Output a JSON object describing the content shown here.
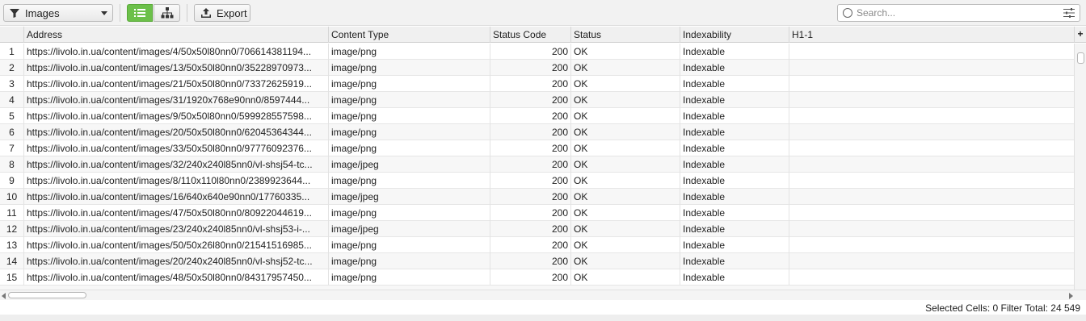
{
  "toolbar": {
    "filter_value": "Images",
    "export_label": "Export",
    "search_placeholder": "Search...",
    "accent_color": "#6cc04a"
  },
  "table": {
    "columns": [
      "",
      "Address",
      "Content Type",
      "Status Code",
      "Status",
      "Indexability",
      "H1-1"
    ],
    "rows": [
      {
        "idx": "1",
        "address": "https://livolo.in.ua/content/images/4/50x50l80nn0/706614381194...",
        "content_type": "image/png",
        "status_code": "200",
        "status": "OK",
        "indexability": "Indexable",
        "h1": ""
      },
      {
        "idx": "2",
        "address": "https://livolo.in.ua/content/images/13/50x50l80nn0/35228970973...",
        "content_type": "image/png",
        "status_code": "200",
        "status": "OK",
        "indexability": "Indexable",
        "h1": ""
      },
      {
        "idx": "3",
        "address": "https://livolo.in.ua/content/images/21/50x50l80nn0/73372625919...",
        "content_type": "image/png",
        "status_code": "200",
        "status": "OK",
        "indexability": "Indexable",
        "h1": ""
      },
      {
        "idx": "4",
        "address": "https://livolo.in.ua/content/images/31/1920x768e90nn0/8597444...",
        "content_type": "image/png",
        "status_code": "200",
        "status": "OK",
        "indexability": "Indexable",
        "h1": ""
      },
      {
        "idx": "5",
        "address": "https://livolo.in.ua/content/images/9/50x50l80nn0/599928557598...",
        "content_type": "image/png",
        "status_code": "200",
        "status": "OK",
        "indexability": "Indexable",
        "h1": ""
      },
      {
        "idx": "6",
        "address": "https://livolo.in.ua/content/images/20/50x50l80nn0/62045364344...",
        "content_type": "image/png",
        "status_code": "200",
        "status": "OK",
        "indexability": "Indexable",
        "h1": ""
      },
      {
        "idx": "7",
        "address": "https://livolo.in.ua/content/images/33/50x50l80nn0/97776092376...",
        "content_type": "image/png",
        "status_code": "200",
        "status": "OK",
        "indexability": "Indexable",
        "h1": ""
      },
      {
        "idx": "8",
        "address": "https://livolo.in.ua/content/images/32/240x240l85nn0/vl-shsj54-tc...",
        "content_type": "image/jpeg",
        "status_code": "200",
        "status": "OK",
        "indexability": "Indexable",
        "h1": ""
      },
      {
        "idx": "9",
        "address": "https://livolo.in.ua/content/images/8/110x110l80nn0/2389923644...",
        "content_type": "image/png",
        "status_code": "200",
        "status": "OK",
        "indexability": "Indexable",
        "h1": ""
      },
      {
        "idx": "10",
        "address": "https://livolo.in.ua/content/images/16/640x640e90nn0/17760335...",
        "content_type": "image/jpeg",
        "status_code": "200",
        "status": "OK",
        "indexability": "Indexable",
        "h1": ""
      },
      {
        "idx": "11",
        "address": "https://livolo.in.ua/content/images/47/50x50l80nn0/80922044619...",
        "content_type": "image/png",
        "status_code": "200",
        "status": "OK",
        "indexability": "Indexable",
        "h1": ""
      },
      {
        "idx": "12",
        "address": "https://livolo.in.ua/content/images/23/240x240l85nn0/vl-shsj53-i-...",
        "content_type": "image/jpeg",
        "status_code": "200",
        "status": "OK",
        "indexability": "Indexable",
        "h1": ""
      },
      {
        "idx": "13",
        "address": "https://livolo.in.ua/content/images/50/50x26l80nn0/21541516985...",
        "content_type": "image/png",
        "status_code": "200",
        "status": "OK",
        "indexability": "Indexable",
        "h1": ""
      },
      {
        "idx": "14",
        "address": "https://livolo.in.ua/content/images/20/240x240l85nn0/vl-shsj52-tc...",
        "content_type": "image/png",
        "status_code": "200",
        "status": "OK",
        "indexability": "Indexable",
        "h1": ""
      },
      {
        "idx": "15",
        "address": "https://livolo.in.ua/content/images/48/50x50l80nn0/84317957450...",
        "content_type": "image/png",
        "status_code": "200",
        "status": "OK",
        "indexability": "Indexable",
        "h1": ""
      }
    ]
  },
  "status_bar": {
    "text": "Selected Cells:  0  Filter Total:  24 549"
  }
}
